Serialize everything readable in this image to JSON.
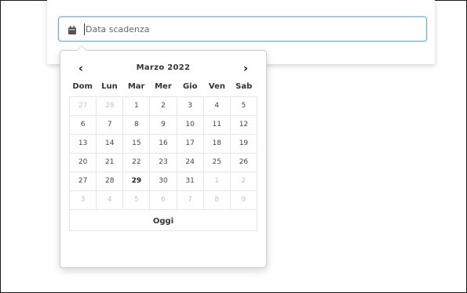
{
  "date_field": {
    "placeholder": "Data scadenza",
    "icon": "calendar-icon"
  },
  "datepicker": {
    "prev_label": "‹",
    "next_label": "›",
    "month_label": "Marzo 2022",
    "weekdays": [
      "Dom",
      "Lun",
      "Mar",
      "Mer",
      "Gio",
      "Ven",
      "Sab"
    ],
    "weeks": [
      [
        {
          "d": "27",
          "m": true
        },
        {
          "d": "28",
          "m": true
        },
        {
          "d": "1"
        },
        {
          "d": "2"
        },
        {
          "d": "3"
        },
        {
          "d": "4"
        },
        {
          "d": "5"
        }
      ],
      [
        {
          "d": "6"
        },
        {
          "d": "7"
        },
        {
          "d": "8"
        },
        {
          "d": "9"
        },
        {
          "d": "10"
        },
        {
          "d": "11"
        },
        {
          "d": "12"
        }
      ],
      [
        {
          "d": "13"
        },
        {
          "d": "14"
        },
        {
          "d": "15"
        },
        {
          "d": "16"
        },
        {
          "d": "17"
        },
        {
          "d": "18"
        },
        {
          "d": "19"
        }
      ],
      [
        {
          "d": "20"
        },
        {
          "d": "21"
        },
        {
          "d": "22"
        },
        {
          "d": "23"
        },
        {
          "d": "24"
        },
        {
          "d": "25"
        },
        {
          "d": "26"
        }
      ],
      [
        {
          "d": "27"
        },
        {
          "d": "28"
        },
        {
          "d": "29",
          "today": true
        },
        {
          "d": "30"
        },
        {
          "d": "31"
        },
        {
          "d": "1",
          "m": true
        },
        {
          "d": "2",
          "m": true
        }
      ],
      [
        {
          "d": "3",
          "m": true
        },
        {
          "d": "4",
          "m": true
        },
        {
          "d": "5",
          "m": true
        },
        {
          "d": "6",
          "m": true
        },
        {
          "d": "7",
          "m": true
        },
        {
          "d": "8",
          "m": true
        },
        {
          "d": "9",
          "m": true
        }
      ]
    ],
    "today_label": "Oggi"
  },
  "colors": {
    "input_focus_border": "#66afe9",
    "muted_day": "#c4c4c4"
  }
}
